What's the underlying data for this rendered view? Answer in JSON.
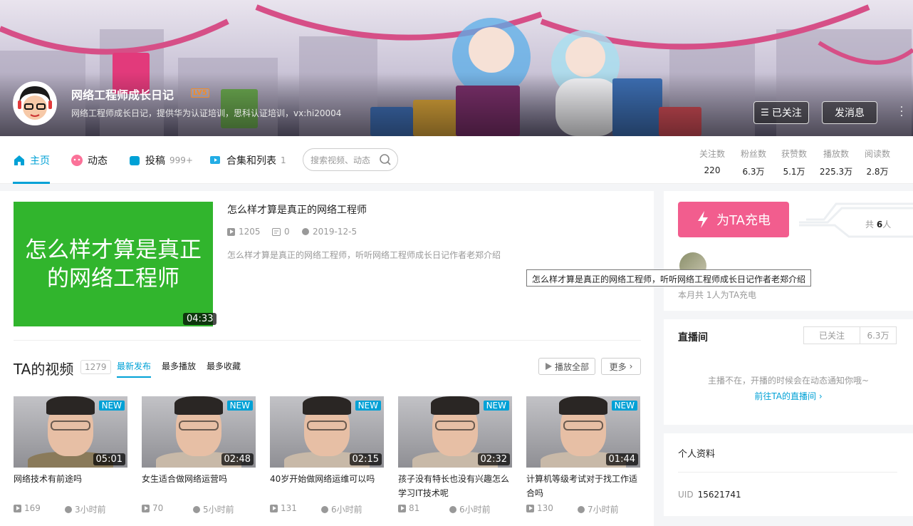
{
  "profile": {
    "name": "网络工程师成长日记",
    "level": "LV5",
    "sign": "网络工程师成长日记，提供华为认证培训，思科认证培训，vx:hi20004",
    "follow_label": "已关注",
    "message_label": "发消息"
  },
  "nav": {
    "items": [
      {
        "label": "主页",
        "icon": "home-icon"
      },
      {
        "label": "动态",
        "icon": "dynamic-icon"
      },
      {
        "label": "投稿",
        "icon": "upload-icon",
        "count": "999+"
      },
      {
        "label": "合集和列表",
        "icon": "collection-icon",
        "count": "1"
      }
    ],
    "search_placeholder": "搜索视频、动态"
  },
  "stats": [
    {
      "label": "关注数",
      "value": "220"
    },
    {
      "label": "粉丝数",
      "value": "6.3万"
    },
    {
      "label": "获赞数",
      "value": "5.1万"
    },
    {
      "label": "播放数",
      "value": "225.3万"
    },
    {
      "label": "阅读数",
      "value": "2.8万"
    }
  ],
  "featured": {
    "thumb_text": "怎么样才算是真正的网络工程师",
    "duration": "04:33",
    "title": "怎么样才算是真正的网络工程师",
    "plays": "1205",
    "danmaku": "0",
    "date": "2019-12-5",
    "desc": "怎么样才算是真正的网络工程师，听听网络工程师成长日记作者老郑介绍",
    "tooltip": "怎么样才算是真正的网络工程师，听听网络工程师成长日记作者老郑介绍"
  },
  "videos_section": {
    "title": "TA的视频",
    "count": "1279",
    "sorts": [
      "最新发布",
      "最多播放",
      "最多收藏"
    ],
    "play_all": "播放全部",
    "more": "更多"
  },
  "videos": [
    {
      "title": "网络技术有前途吗",
      "duration": "05:01",
      "badge": "NEW",
      "plays": "169",
      "time": "3小时前",
      "shirt": "#8a7a5a"
    },
    {
      "title": "女生适合做网络运营吗",
      "duration": "02:48",
      "badge": "NEW",
      "plays": "70",
      "time": "5小时前",
      "shirt": "#c8b9a8"
    },
    {
      "title": "40岁开始做网络运维可以吗",
      "duration": "02:15",
      "badge": "NEW",
      "plays": "131",
      "time": "6小时前",
      "shirt": "#c8b9a8"
    },
    {
      "title": "孩子没有特长也没有兴趣怎么学习IT技术呢",
      "duration": "02:32",
      "badge": "NEW",
      "plays": "81",
      "time": "6小时前",
      "shirt": "#c8b9a8"
    },
    {
      "title": "计算机等级考试对于找工作适合吗",
      "duration": "01:44",
      "badge": "NEW",
      "plays": "130",
      "time": "7小时前",
      "shirt": "#c8b9a8"
    }
  ],
  "charge": {
    "button": "为TA充电",
    "total_prefix": "共",
    "total_count": "6",
    "total_suffix": "人",
    "month": "本月共 1人为TA充电"
  },
  "live": {
    "title": "直播间",
    "follow": "已关注",
    "fans": "6.3万",
    "empty": "主播不在，开播的时候会在动态通知你哦~",
    "link": "前往TA的直播间"
  },
  "personal": {
    "title": "个人资料",
    "uid_label": "UID",
    "uid": "15621741"
  },
  "colors": {
    "accent": "#00a1d6",
    "charge": "#f25d8e",
    "featured_bg": "#31b52d"
  }
}
